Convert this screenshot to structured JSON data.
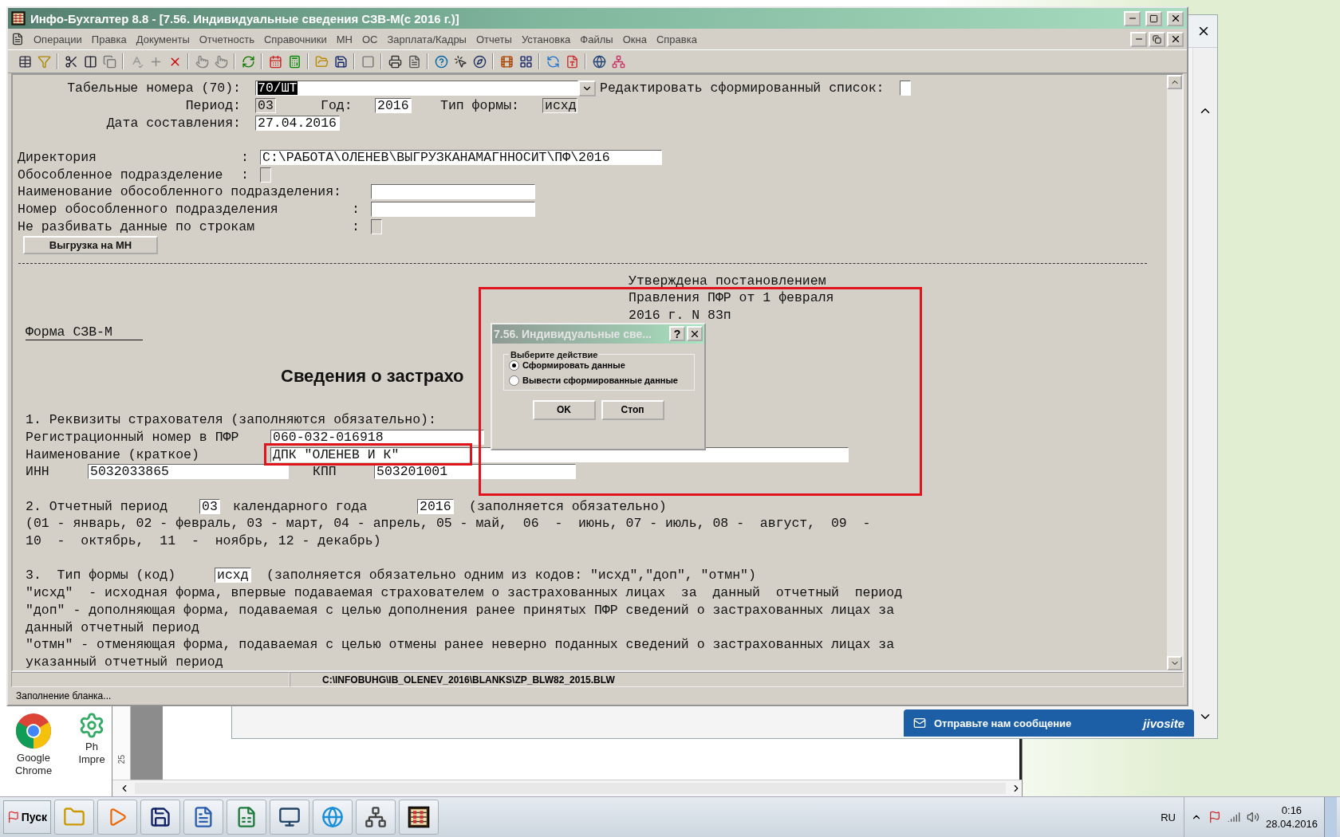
{
  "window": {
    "title": "Инфо-Бухгалтер 8.8 - [7.56. Индивидуальные сведения СЗВ-М(с 2016 г.)]"
  },
  "menu": [
    "Операции",
    "Правка",
    "Документы",
    "Отчетность",
    "Справочники",
    "МН",
    "ОС",
    "Зарплата/Кадры",
    "Отчеты",
    "Установка",
    "Файлы",
    "Окна",
    "Справка"
  ],
  "settings": {
    "tab_numbers": {
      "label": "Табельные номера (70):",
      "value": "70/ШТ",
      "value_selected": true
    },
    "edit_list": {
      "label": "Редактировать сформированный список:",
      "checked": false
    },
    "period": {
      "label": "Период:",
      "value": "03"
    },
    "year": {
      "label": "Год:",
      "value": "2016"
    },
    "form_type": {
      "label": "Тип формы:",
      "value": "исхд"
    },
    "date": {
      "label": "Дата составления:",
      "value": "27.04.2016"
    },
    "fields": [
      {
        "kind": "text",
        "label": "Директория",
        "colon": ":",
        "value": "C:\\РАБОТА\\ОЛЕНЕВ\\ВЫГРУЗКАНАМАГННОСИТ\\ПФ\\2016"
      },
      {
        "kind": "checkbox",
        "label": "Обособленное подразделение",
        "colon": ":",
        "checked": false
      },
      {
        "kind": "text",
        "label": "Наименование обособленного подразделения:"
      },
      {
        "kind": "text",
        "label": "Номер обособленного подразделения",
        "colon": ":"
      },
      {
        "kind": "checkbox",
        "label": "Не разбивать данные по строкам",
        "colon": ":",
        "checked": false
      }
    ],
    "export_button": "Выгрузка на МН"
  },
  "form": {
    "approval": [
      "Утверждена постановлением",
      "Правления ПФР от 1 февраля",
      "2016 г. N 83п"
    ],
    "form_name": "Форма СЗВ-М",
    "heading": "Сведения о застрахо",
    "section1": {
      "title": "1. Реквизиты страхователя (заполняются обязательно):",
      "reg_number": {
        "label": "Регистрационный номер в ПФР",
        "value": "060-032-016918"
      },
      "name": {
        "label": "Наименование (краткое)",
        "value": "ДПК \"ОЛЕНЕВ И К\""
      },
      "inn": {
        "label": "ИНН",
        "value": "5032033865"
      },
      "kpp": {
        "label": "КПП",
        "value": "503201001"
      }
    },
    "section2": {
      "label": "2. Отчетный период",
      "period": "03",
      "year_label": "календарного года",
      "year": "2016",
      "note": "(заполняется обязательно)",
      "legend": [
        "(01 - январь, 02 - февраль, 03 - март, 04 - апрель, 05 - май,  06  -  июнь, 07 - июль, 08 -  август,  09  -",
        "10  -  октябрь,  11  -  ноябрь, 12 - декабрь)"
      ]
    },
    "section3": {
      "label": "3.  Тип формы (код)",
      "value": "исхд",
      "note": "(заполняется обязательно одним из кодов: \"исхд\",\"доп\", \"отмн\")",
      "lines": [
        "\"исхд\"  - исходная форма, впервые подаваемая страхователем о застрахованных лицах  за  данный  отчетный  период",
        "\"доп\" - дополняющая форма, подаваемая с целью дополнения ранее принятых ПФР сведений о застрахованных лицах за",
        "данный отчетный период",
        "\"отмн\" - отменяющая форма, подаваемая с целью отмены ранее неверно поданных сведений о застрахованных лицах за",
        "указанный отчетный период"
      ]
    }
  },
  "dialog": {
    "title": "7.56. Индивидуальные све...",
    "help": "?",
    "group_label": "Выберите действие",
    "options": [
      {
        "label": "Сформировать данные",
        "selected": true
      },
      {
        "label": "Вывести сформированные данные",
        "selected": false
      }
    ],
    "buttons": [
      "OK",
      "Стоп"
    ]
  },
  "path_bar": "C:\\INFOBUHG\\IB_OLENEV_2016\\BLANKS\\ZP_BLW82_2015.BLW",
  "status": "Заполнение бланка...",
  "desktop_icons": [
    {
      "label": "Google Chrome"
    },
    {
      "label": "Ph Impre"
    }
  ],
  "chat_banner": {
    "text": "Отправьте нам сообщение",
    "brand": "jivosite"
  },
  "ruler": "25",
  "taskbar": {
    "start": "Пуск",
    "language": "RU",
    "time": "0:16",
    "date": "28.04.2016"
  }
}
